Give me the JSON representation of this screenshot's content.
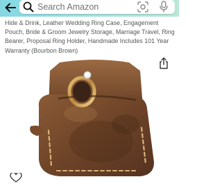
{
  "header": {
    "search_placeholder": "Search Amazon",
    "background_colors": [
      "#84d8e4",
      "#b8e8d6"
    ],
    "back_icon": "back-arrow-icon",
    "search_icon": "search-icon",
    "camera_icon": "camera-scan-icon",
    "mic_icon": "microphone-icon"
  },
  "product": {
    "title": "Hide & Drink, Leather Wedding Ring Case, Engagement Pouch, Bride & Groom Jewelry Storage, Marriage Travel, Ring Bearer, Proposal Ring Holder, Handmade Includes 101 Year Warranty (Bourbon Brown)",
    "share_icon": "share-icon",
    "wishlist_icon": "heart-icon",
    "image_icon": "leather-ring-pouch-image"
  }
}
